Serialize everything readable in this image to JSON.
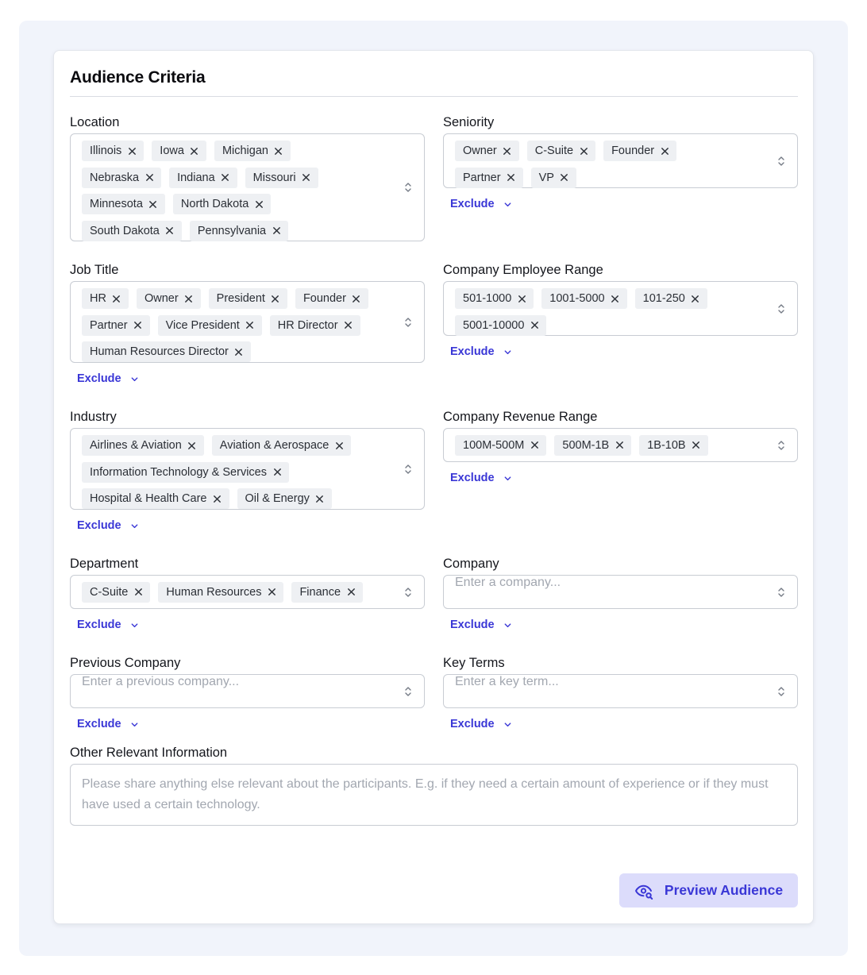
{
  "title": "Audience Criteria",
  "exclude_label": "Exclude",
  "fields": {
    "location": {
      "label": "Location",
      "chips": [
        "Illinois",
        "Iowa",
        "Michigan",
        "Nebraska",
        "Indiana",
        "Missouri",
        "Minnesota",
        "North Dakota",
        "South Dakota",
        "Pennsylvania"
      ]
    },
    "seniority": {
      "label": "Seniority",
      "chips": [
        "Owner",
        "C-Suite",
        "Founder",
        "Partner",
        "VP"
      ]
    },
    "job_title": {
      "label": "Job Title",
      "chips": [
        "HR",
        "Owner",
        "President",
        "Founder",
        "Partner",
        "Vice President",
        "HR Director",
        "Human Resources Director"
      ]
    },
    "employee_range": {
      "label": "Company Employee Range",
      "chips": [
        "501-1000",
        "1001-5000",
        "101-250",
        "5001-10000"
      ]
    },
    "industry": {
      "label": "Industry",
      "chips": [
        "Airlines & Aviation",
        "Aviation & Aerospace",
        "Information Technology & Services",
        "Hospital & Health Care",
        "Oil & Energy"
      ]
    },
    "revenue_range": {
      "label": "Company Revenue Range",
      "chips": [
        "100M-500M",
        "500M-1B",
        "1B-10B"
      ]
    },
    "department": {
      "label": "Department",
      "chips": [
        "C-Suite",
        "Human Resources",
        "Finance"
      ]
    },
    "company": {
      "label": "Company",
      "placeholder": "Enter a company..."
    },
    "previous_company": {
      "label": "Previous Company",
      "placeholder": "Enter a previous company..."
    },
    "key_terms": {
      "label": "Key Terms",
      "placeholder": "Enter a key term..."
    },
    "other_info": {
      "label": "Other Relevant Information",
      "placeholder": "Please share anything else relevant about the participants. E.g. if they need a certain amount of experience or if they must have used a certain technology."
    }
  },
  "preview_button": {
    "label": "Preview Audience",
    "icon": "eye-search-icon"
  },
  "colors": {
    "accent": "#3a37d6",
    "button_bg": "#dcdcfb",
    "page_bg": "#f1f4fb",
    "chip_bg": "#eef0f3"
  }
}
